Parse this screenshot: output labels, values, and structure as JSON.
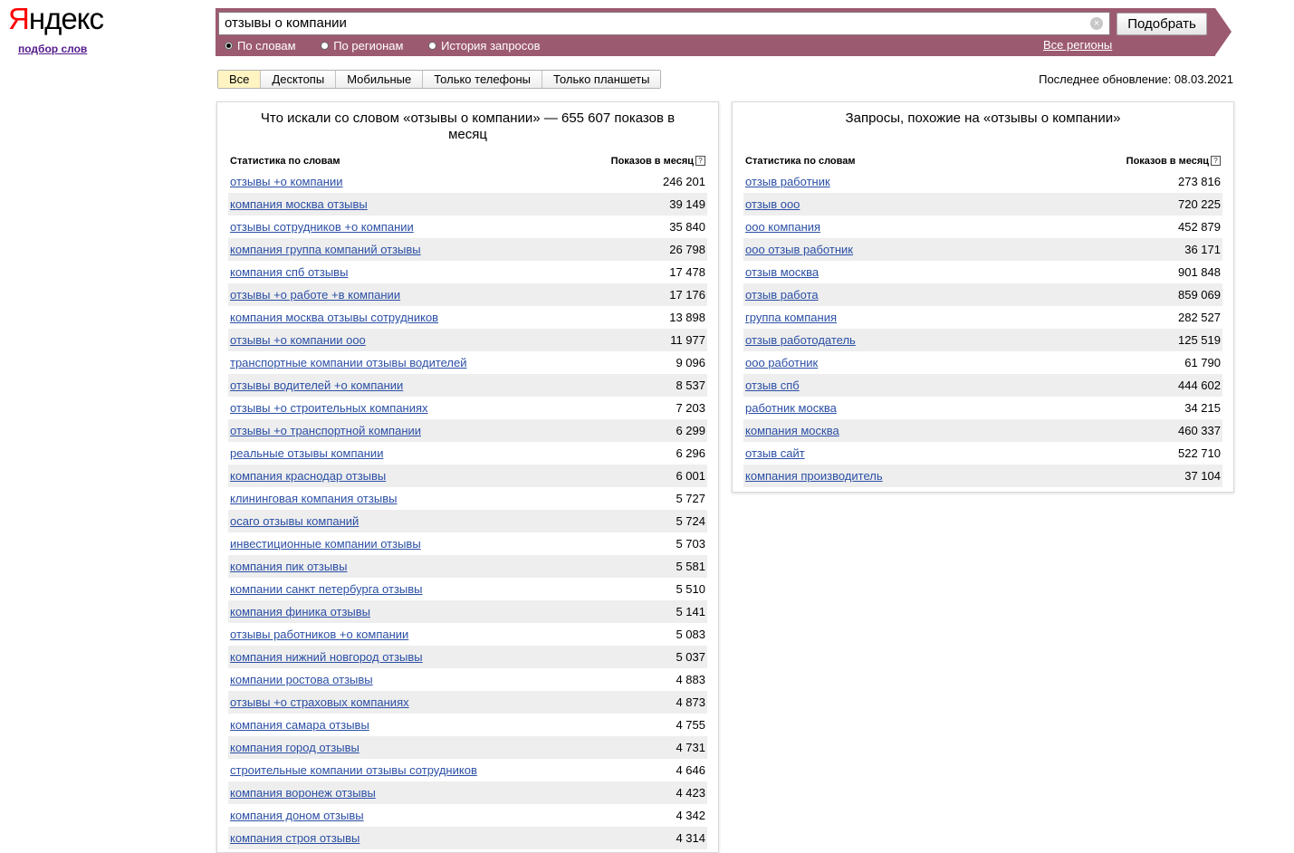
{
  "logo": {
    "first": "Я",
    "rest": "ндекс"
  },
  "sublink": "подбор слов",
  "search": {
    "value": "отзывы о компании",
    "button": "Подобрать"
  },
  "radios": [
    {
      "label": "По словам",
      "selected": true
    },
    {
      "label": "По регионам",
      "selected": false
    },
    {
      "label": "История запросов",
      "selected": false
    }
  ],
  "all_regions": "Все регионы",
  "tabs": [
    "Все",
    "Десктопы",
    "Мобильные",
    "Только телефоны",
    "Только планшеты"
  ],
  "updated": "Последнее обновление: 08.03.2021",
  "left": {
    "title": "Что искали со словом «отзывы о компании» — 655 607 показов в месяц",
    "col1": "Статистика по словам",
    "col2": "Показов в месяц",
    "rows": [
      [
        "отзывы +о компании",
        "246 201"
      ],
      [
        "компания москва отзывы",
        "39 149"
      ],
      [
        "отзывы сотрудников +о компании",
        "35 840"
      ],
      [
        "компания группа компаний отзывы",
        "26 798"
      ],
      [
        "компания спб отзывы",
        "17 478"
      ],
      [
        "отзывы +о работе +в компании",
        "17 176"
      ],
      [
        "компания москва отзывы сотрудников",
        "13 898"
      ],
      [
        "отзывы +о компании ооо",
        "11 977"
      ],
      [
        "транспортные компании отзывы водителей",
        "9 096"
      ],
      [
        "отзывы водителей +о компании",
        "8 537"
      ],
      [
        "отзывы +о строительных компаниях",
        "7 203"
      ],
      [
        "отзывы +о транспортной компании",
        "6 299"
      ],
      [
        "реальные отзывы компании",
        "6 296"
      ],
      [
        "компания краснодар отзывы",
        "6 001"
      ],
      [
        "клининговая компания отзывы",
        "5 727"
      ],
      [
        "осаго отзывы компаний",
        "5 724"
      ],
      [
        "инвестиционные компании отзывы",
        "5 703"
      ],
      [
        "компания пик отзывы",
        "5 581"
      ],
      [
        "компании санкт петербурга отзывы",
        "5 510"
      ],
      [
        "компания финика отзывы",
        "5 141"
      ],
      [
        "отзывы работников +о компании",
        "5 083"
      ],
      [
        "компания нижний новгород отзывы",
        "5 037"
      ],
      [
        "компании ростова отзывы",
        "4 883"
      ],
      [
        "отзывы +о страховых компаниях",
        "4 873"
      ],
      [
        "компания самара отзывы",
        "4 755"
      ],
      [
        "компания город отзывы",
        "4 731"
      ],
      [
        "строительные компании отзывы сотрудников",
        "4 646"
      ],
      [
        "компания воронеж отзывы",
        "4 423"
      ],
      [
        "компания доном отзывы",
        "4 342"
      ],
      [
        "компания строя отзывы",
        "4 314"
      ]
    ]
  },
  "right": {
    "title": "Запросы, похожие на «отзывы о компании»",
    "col1": "Статистика по словам",
    "col2": "Показов в месяц",
    "rows": [
      [
        "отзыв работник",
        "273 816"
      ],
      [
        "отзыв ооо",
        "720 225"
      ],
      [
        "ооо компания",
        "452 879"
      ],
      [
        "ооо отзыв работник",
        "36 171"
      ],
      [
        "отзыв москва",
        "901 848"
      ],
      [
        "отзыв работа",
        "859 069"
      ],
      [
        "группа компания",
        "282 527"
      ],
      [
        "отзыв работодатель",
        "125 519"
      ],
      [
        "ооо работник",
        "61 790"
      ],
      [
        "отзыв спб",
        "444 602"
      ],
      [
        "работник москва",
        "34 215"
      ],
      [
        "компания москва",
        "460 337"
      ],
      [
        "отзыв сайт",
        "522 710"
      ],
      [
        "компания производитель",
        "37 104"
      ]
    ]
  }
}
